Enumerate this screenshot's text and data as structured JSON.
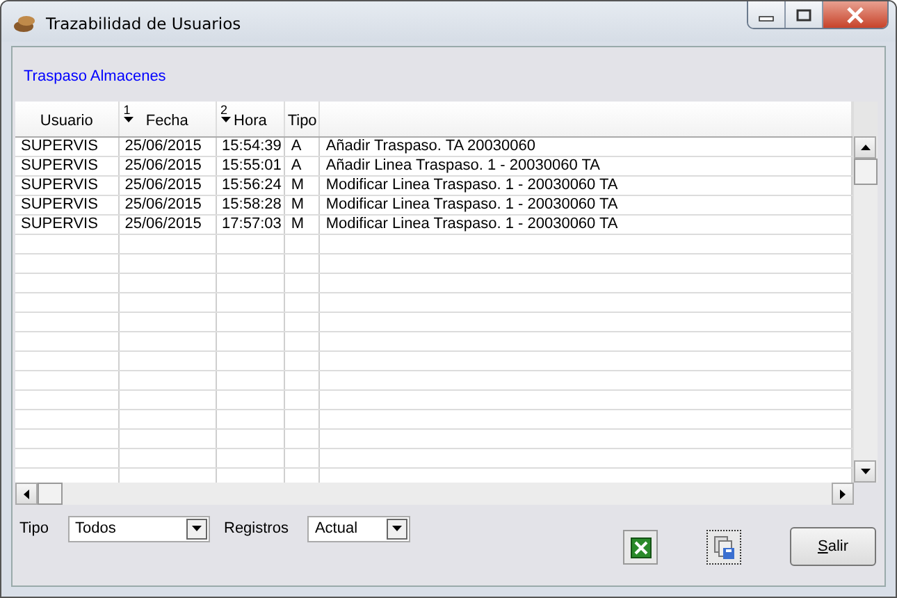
{
  "window": {
    "title": "Trazabilidad de Usuarios"
  },
  "section_link": "Traspaso Almacenes",
  "table": {
    "columns": [
      {
        "label": "Usuario"
      },
      {
        "label": "Fecha",
        "sort": "1"
      },
      {
        "label": "Hora",
        "sort": "2"
      },
      {
        "label": "Tipo"
      },
      {}
    ],
    "rows": [
      [
        "SUPERVIS",
        "25/06/2015",
        "15:54:39",
        "A",
        "Añadir Traspaso.  TA 20030060"
      ],
      [
        "SUPERVIS",
        "25/06/2015",
        "15:55:01",
        "A",
        "Añadir Linea Traspaso.  1 - 20030060 TA"
      ],
      [
        "SUPERVIS",
        "25/06/2015",
        "15:56:24",
        "M",
        "Modificar Linea Traspaso.  1 - 20030060 TA"
      ],
      [
        "SUPERVIS",
        "25/06/2015",
        "15:58:28",
        "M",
        "Modificar Linea Traspaso.  1 - 20030060 TA"
      ],
      [
        "SUPERVIS",
        "25/06/2015",
        "17:57:03",
        "M",
        "Modificar Linea Traspaso.  1 - 20030060 TA"
      ]
    ]
  },
  "filters": [
    {
      "label": "Tipo",
      "value": "Todos"
    },
    {
      "label": "Registros",
      "value": "Actual"
    }
  ],
  "buttons": {
    "close": "Salir"
  }
}
